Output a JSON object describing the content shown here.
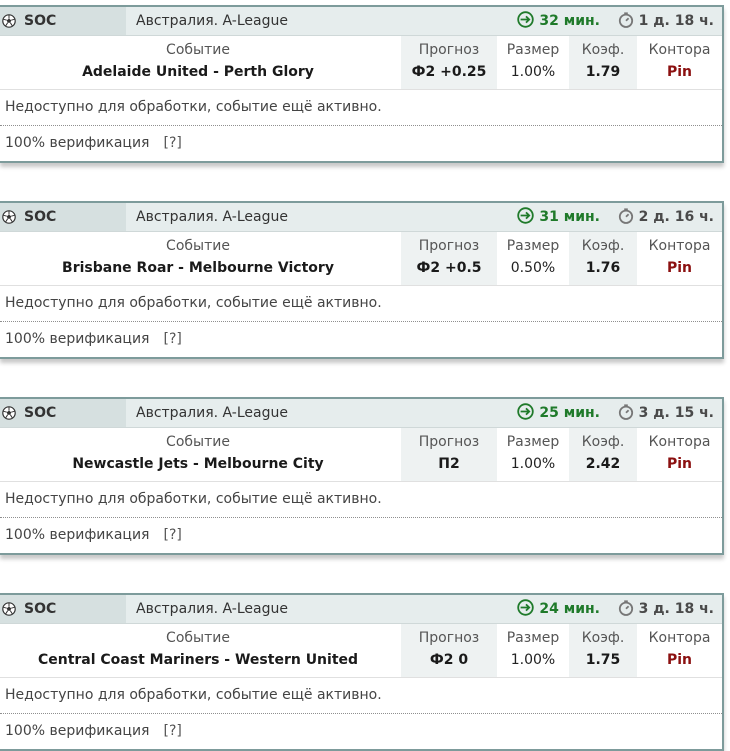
{
  "labels": {
    "event": "Событие",
    "tip": "Прогноз",
    "size": "Размер",
    "odds": "Коэф.",
    "bookmaker": "Контора",
    "status": "Недоступно для обработки, событие ещё активно.",
    "verification": "100% верификация",
    "help": "[?]"
  },
  "icons": {
    "sport": "soccer-ball-icon",
    "live": "arrow-circle-icon",
    "start": "stopwatch-icon"
  },
  "colors": {
    "live_green": "#1f7a2a",
    "bookmaker_red": "#8b1010",
    "border": "#7d9b9b"
  },
  "cards": [
    {
      "sport": "SOC",
      "league": "Австралия. A-League",
      "live": "32 мин.",
      "start": "1 д. 18 ч.",
      "event": "Adelaide United - Perth Glory",
      "tip": "Ф2 +0.25",
      "size": "1.00%",
      "odds": "1.79",
      "bookmaker": "Pin"
    },
    {
      "sport": "SOC",
      "league": "Австралия. A-League",
      "live": "31 мин.",
      "start": "2 д. 16 ч.",
      "event": "Brisbane Roar - Melbourne Victory",
      "tip": "Ф2 +0.5",
      "size": "0.50%",
      "odds": "1.76",
      "bookmaker": "Pin"
    },
    {
      "sport": "SOC",
      "league": "Австралия. A-League",
      "live": "25 мин.",
      "start": "3 д. 15 ч.",
      "event": "Newcastle Jets - Melbourne City",
      "tip": "П2",
      "size": "1.00%",
      "odds": "2.42",
      "bookmaker": "Pin"
    },
    {
      "sport": "SOC",
      "league": "Австралия. A-League",
      "live": "24 мин.",
      "start": "3 д. 18 ч.",
      "event": "Central Coast Mariners - Western United",
      "tip": "Ф2 0",
      "size": "1.00%",
      "odds": "1.75",
      "bookmaker": "Pin"
    }
  ]
}
